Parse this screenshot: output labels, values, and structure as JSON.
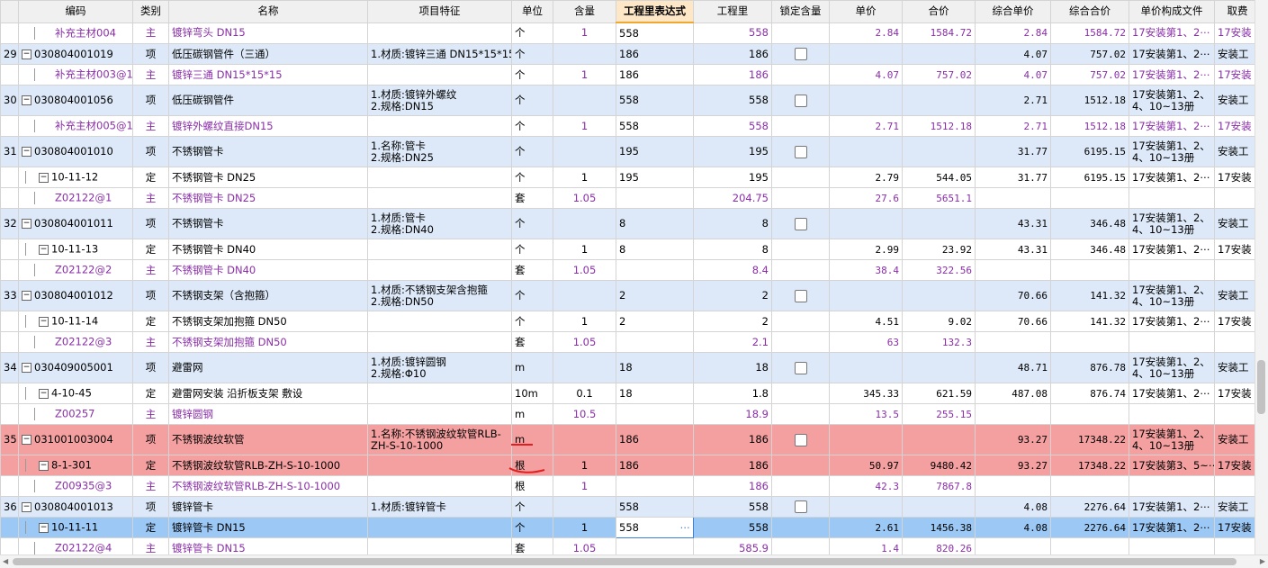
{
  "columns": [
    "编码",
    "类别",
    "名称",
    "项目特征",
    "单位",
    "含量",
    "工程里表达式",
    "工程里",
    "锁定含量",
    "单价",
    "合价",
    "综合单价",
    "综合合价",
    "单价构成文件",
    "取费"
  ],
  "rows": [
    {
      "kind": "main",
      "rn": "",
      "code": "补充主材004",
      "cat": "主",
      "name": "镀锌弯头 DN15",
      "feat": "",
      "unit": "个",
      "qty": "1",
      "expr": "558",
      "amt": "558",
      "lock": false,
      "price": "2.84",
      "total": "1584.72",
      "uprice": "2.84",
      "utotal": "1584.72",
      "file": "17安装第1、2⋯",
      "fee": "17安装"
    },
    {
      "kind": "item",
      "rn": "29",
      "code": "030804001019",
      "cat": "项",
      "name": "低压碳钢管件（三通）",
      "feat": "1.材质:镀锌三通 DN15*15*15",
      "unit": "个",
      "qty": "",
      "expr": "186",
      "amt": "186",
      "lock": true,
      "price": "",
      "total": "",
      "uprice": "4.07",
      "utotal": "757.02",
      "file": "17安装第1、2⋯",
      "fee": "安装工"
    },
    {
      "kind": "main",
      "rn": "",
      "code": "补充主材003@1",
      "cat": "主",
      "name": "镀锌三通 DN15*15*15",
      "feat": "",
      "unit": "个",
      "qty": "1",
      "expr": "186",
      "amt": "186",
      "lock": false,
      "price": "4.07",
      "total": "757.02",
      "uprice": "4.07",
      "utotal": "757.02",
      "file": "17安装第1、2⋯",
      "fee": "17安装"
    },
    {
      "kind": "item",
      "tall": true,
      "rn": "30",
      "code": "030804001056",
      "cat": "项",
      "name": "低压碳钢管件",
      "feat": "1.材质:镀锌外螺纹\n2.规格:DN15",
      "unit": "个",
      "qty": "",
      "expr": "558",
      "amt": "558",
      "lock": true,
      "price": "",
      "total": "",
      "uprice": "2.71",
      "utotal": "1512.18",
      "file": "17安装第1、2、\n4、10~13册",
      "fee": "安装工"
    },
    {
      "kind": "main",
      "rn": "",
      "code": "补充主材005@1",
      "cat": "主",
      "name": "镀锌外螺纹直接DN15",
      "feat": "",
      "unit": "个",
      "qty": "1",
      "expr": "558",
      "amt": "558",
      "lock": false,
      "price": "2.71",
      "total": "1512.18",
      "uprice": "2.71",
      "utotal": "1512.18",
      "file": "17安装第1、2⋯",
      "fee": "17安装"
    },
    {
      "kind": "item",
      "tall": true,
      "rn": "31",
      "code": "030804001010",
      "cat": "项",
      "name": "不锈钢管卡",
      "feat": "1.名称:管卡\n2.规格:DN25",
      "unit": "个",
      "qty": "",
      "expr": "195",
      "amt": "195",
      "lock": true,
      "price": "",
      "total": "",
      "uprice": "31.77",
      "utotal": "6195.15",
      "file": "17安装第1、2、\n4、10~13册",
      "fee": "安装工"
    },
    {
      "kind": "sub",
      "rn": "",
      "code": "10-11-12",
      "cat": "定",
      "name": "不锈钢管卡 DN25",
      "feat": "",
      "unit": "个",
      "qty": "1",
      "expr": "195",
      "amt": "195",
      "lock": false,
      "price": "2.79",
      "total": "544.05",
      "uprice": "31.77",
      "utotal": "6195.15",
      "file": "17安装第1、2⋯",
      "fee": "17安装"
    },
    {
      "kind": "main",
      "rn": "",
      "code": "Z02122@1",
      "cat": "主",
      "name": "不锈钢管卡 DN25",
      "feat": "",
      "unit": "套",
      "qty": "1.05",
      "expr": "",
      "amt": "204.75",
      "lock": false,
      "price": "27.6",
      "total": "5651.1",
      "uprice": "",
      "utotal": "",
      "file": "",
      "fee": ""
    },
    {
      "kind": "item",
      "tall": true,
      "rn": "32",
      "code": "030804001011",
      "cat": "项",
      "name": "不锈钢管卡",
      "feat": "1.材质:管卡\n2.规格:DN40",
      "unit": "个",
      "qty": "",
      "expr": "8",
      "amt": "8",
      "lock": true,
      "price": "",
      "total": "",
      "uprice": "43.31",
      "utotal": "346.48",
      "file": "17安装第1、2、\n4、10~13册",
      "fee": "安装工"
    },
    {
      "kind": "sub",
      "rn": "",
      "code": "10-11-13",
      "cat": "定",
      "name": "不锈钢管卡 DN40",
      "feat": "",
      "unit": "个",
      "qty": "1",
      "expr": "8",
      "amt": "8",
      "lock": false,
      "price": "2.99",
      "total": "23.92",
      "uprice": "43.31",
      "utotal": "346.48",
      "file": "17安装第1、2⋯",
      "fee": "17安装"
    },
    {
      "kind": "main",
      "rn": "",
      "code": "Z02122@2",
      "cat": "主",
      "name": "不锈钢管卡 DN40",
      "feat": "",
      "unit": "套",
      "qty": "1.05",
      "expr": "",
      "amt": "8.4",
      "lock": false,
      "price": "38.4",
      "total": "322.56",
      "uprice": "",
      "utotal": "",
      "file": "",
      "fee": ""
    },
    {
      "kind": "item",
      "tall": true,
      "rn": "33",
      "code": "030804001012",
      "cat": "项",
      "name": "不锈钢支架（含抱箍）",
      "feat": "1.材质:不锈钢支架含抱箍\n2.规格:DN50",
      "unit": "个",
      "qty": "",
      "expr": "2",
      "amt": "2",
      "lock": true,
      "price": "",
      "total": "",
      "uprice": "70.66",
      "utotal": "141.32",
      "file": "17安装第1、2、\n4、10~13册",
      "fee": "安装工"
    },
    {
      "kind": "sub",
      "rn": "",
      "code": "10-11-14",
      "cat": "定",
      "name": "不锈钢支架加抱箍 DN50",
      "feat": "",
      "unit": "个",
      "qty": "1",
      "expr": "2",
      "amt": "2",
      "lock": false,
      "price": "4.51",
      "total": "9.02",
      "uprice": "70.66",
      "utotal": "141.32",
      "file": "17安装第1、2⋯",
      "fee": "17安装"
    },
    {
      "kind": "main",
      "rn": "",
      "code": "Z02122@3",
      "cat": "主",
      "name": "不锈钢支架加抱箍 DN50",
      "feat": "",
      "unit": "套",
      "qty": "1.05",
      "expr": "",
      "amt": "2.1",
      "lock": false,
      "price": "63",
      "total": "132.3",
      "uprice": "",
      "utotal": "",
      "file": "",
      "fee": ""
    },
    {
      "kind": "item",
      "tall": true,
      "rn": "34",
      "code": "030409005001",
      "cat": "项",
      "name": "避雷网",
      "feat": "1.材质:镀锌圆钢\n2.规格:Φ10",
      "unit": "m",
      "qty": "",
      "expr": "18",
      "amt": "18",
      "lock": true,
      "price": "",
      "total": "",
      "uprice": "48.71",
      "utotal": "876.78",
      "file": "17安装第1、2、\n4、10~13册",
      "fee": "安装工"
    },
    {
      "kind": "sub",
      "rn": "",
      "code": "4-10-45",
      "cat": "定",
      "name": "避雷网安装 沿折板支架 敷设",
      "feat": "",
      "unit": "10m",
      "qty": "0.1",
      "expr": "18",
      "amt": "1.8",
      "lock": false,
      "price": "345.33",
      "total": "621.59",
      "uprice": "487.08",
      "utotal": "876.74",
      "file": "17安装第1、2⋯",
      "fee": "17安装"
    },
    {
      "kind": "main",
      "rn": "",
      "code": "Z00257",
      "cat": "主",
      "name": "镀锌圆钢",
      "feat": "",
      "unit": "m",
      "qty": "10.5",
      "expr": "",
      "amt": "18.9",
      "lock": false,
      "price": "13.5",
      "total": "255.15",
      "uprice": "",
      "utotal": "",
      "file": "",
      "fee": ""
    },
    {
      "kind": "red",
      "tall": true,
      "rn": "35",
      "code": "031001003004",
      "cat": "项",
      "name": "不锈钢波纹软管",
      "feat": "1.名称:不锈钢波纹软管RLB-\nZH-S-10-1000",
      "unit": "m",
      "qty": "",
      "expr": "186",
      "amt": "186",
      "lock": true,
      "price": "",
      "total": "",
      "uprice": "93.27",
      "utotal": "17348.22",
      "file": "17安装第1、2、\n4、10~13册",
      "fee": "安装工"
    },
    {
      "kind": "red",
      "rn": "",
      "code": "8-1-301",
      "cat": "定",
      "name": "不锈钢波纹软管RLB-ZH-S-10-1000",
      "feat": "",
      "unit": "根",
      "qty": "1",
      "expr": "186",
      "amt": "186",
      "lock": false,
      "price": "50.97",
      "total": "9480.42",
      "uprice": "93.27",
      "utotal": "17348.22",
      "file": "17安装第3、5~⋯",
      "fee": "17安装"
    },
    {
      "kind": "main",
      "rn": "",
      "code": "Z00935@3",
      "cat": "主",
      "name": "不锈钢波纹软管RLB-ZH-S-10-1000",
      "feat": "",
      "unit": "根",
      "qty": "1",
      "expr": "",
      "amt": "186",
      "lock": false,
      "price": "42.3",
      "total": "7867.8",
      "uprice": "",
      "utotal": "",
      "file": "",
      "fee": ""
    },
    {
      "kind": "item",
      "rn": "36",
      "code": "030804001013",
      "cat": "项",
      "name": "镀锌管卡",
      "feat": "1.材质:镀锌管卡",
      "unit": "个",
      "qty": "",
      "expr": "558",
      "amt": "558",
      "lock": true,
      "price": "",
      "total": "",
      "uprice": "4.08",
      "utotal": "2276.64",
      "file": "17安装第1、2⋯",
      "fee": "安装工"
    },
    {
      "kind": "selected",
      "rn": "",
      "code": "10-11-11",
      "cat": "定",
      "name": "镀锌管卡 DN15",
      "feat": "",
      "unit": "个",
      "qty": "1",
      "expr": "558",
      "amt": "558",
      "lock": false,
      "price": "2.61",
      "total": "1456.38",
      "uprice": "4.08",
      "utotal": "2276.64",
      "file": "17安装第1、2⋯",
      "fee": "17安装"
    },
    {
      "kind": "main",
      "rn": "",
      "code": "Z02122@4",
      "cat": "主",
      "name": "镀锌管卡 DN15",
      "feat": "",
      "unit": "套",
      "qty": "1.05",
      "expr": "",
      "amt": "585.9",
      "lock": false,
      "price": "1.4",
      "total": "820.26",
      "uprice": "",
      "utotal": "",
      "file": "",
      "fee": ""
    }
  ],
  "colors": {
    "item": "#dde9f8",
    "red": "#f4a0a0",
    "selected": "#9cc8f5",
    "main_text": "#8a2ea8",
    "annotation": "#e02020"
  }
}
